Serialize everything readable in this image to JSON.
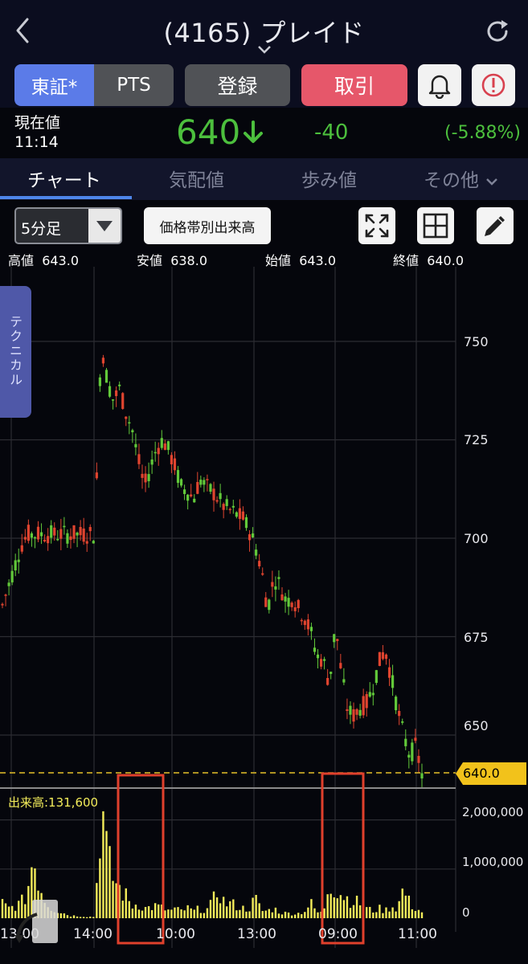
{
  "header": {
    "title": "(4165) プレイド"
  },
  "buttons": {
    "tse": "東証*",
    "pts": "PTS",
    "register": "登録",
    "trade": "取引"
  },
  "price": {
    "label": "現在値",
    "time": "11:14",
    "value": "640",
    "change": "-40",
    "change_pct": "(-5.88%)",
    "color_down": "#4cbf3d"
  },
  "tabs": [
    {
      "label": "チャート",
      "active": true
    },
    {
      "label": "気配値"
    },
    {
      "label": "歩み値"
    },
    {
      "label": "その他"
    }
  ],
  "toolbar": {
    "interval": "5分足",
    "volume_profile": "価格帯別出来高"
  },
  "ohlc": {
    "high_label": "高値",
    "high": "643.0",
    "low_label": "安値",
    "low": "638.0",
    "open_label": "始値",
    "open": "643.0",
    "close_label": "終値",
    "close": "640.0"
  },
  "side_tab": "テクニカル",
  "chart": {
    "y_ticks": [
      "750",
      "725",
      "700",
      "675",
      "650"
    ],
    "last_price_tag": "640.0",
    "volume_label": "出来高:131,600",
    "volume_ticks": [
      "2,000,000",
      "1,000,000",
      "0"
    ],
    "x_ticks": [
      "13:00",
      "14:00",
      "10:00",
      "13:00",
      "09:00",
      "11:00"
    ],
    "up_color": "#e0442f",
    "down_color": "#62c93a",
    "highlight_color": "#e0402c"
  },
  "chart_data": {
    "type": "candlestick",
    "y_ticks": [
      750,
      725,
      700,
      675,
      650
    ],
    "last_price": 640.0,
    "volume_y_ticks": [
      2000000,
      1000000,
      0
    ],
    "x_ticks": [
      "13:00",
      "14:00",
      "10:00",
      "13:00",
      "09:00",
      "11:00"
    ],
    "price_path": [
      683,
      688,
      693,
      698,
      701,
      701,
      701,
      701,
      701,
      701,
      701,
      701,
      701,
      701,
      701,
      701,
      750,
      740,
      735,
      738,
      732,
      728,
      720,
      713,
      718,
      723,
      725,
      722,
      718,
      713,
      712,
      710,
      715,
      713,
      712,
      710,
      708,
      707,
      706,
      705,
      702,
      698,
      692,
      682,
      690,
      688,
      684,
      685,
      682,
      680,
      676,
      670,
      669,
      663,
      678,
      665,
      656,
      655,
      657,
      658,
      662,
      668,
      672,
      665,
      657,
      650,
      645,
      647,
      640
    ],
    "volume_path": [
      0.3,
      0.2,
      0.25,
      0.3,
      0.5,
      1.3,
      0.7,
      0.35,
      0.2,
      0.15,
      0.1,
      0.05,
      0.05,
      0.04,
      0.03,
      0.03,
      2.4,
      1.2,
      0.8,
      0.6,
      0.45,
      0.25,
      0.3,
      0.2,
      0.22,
      0.25,
      0.2,
      0.15,
      0.18,
      0.15,
      0.2,
      0.14,
      0.2,
      0.15,
      0.3,
      0.6,
      0.3,
      0.3,
      0.25,
      0.2,
      0.2,
      0.4,
      0.15,
      0.15,
      0.2,
      0.12,
      0.1,
      0.1,
      0.1,
      0.15,
      0.3,
      0.12,
      0.1,
      0.8,
      0.6,
      0.5,
      0.4,
      0.35,
      0.3,
      0.2,
      0.15,
      0.2,
      0.15,
      0.25,
      0.2,
      0.6,
      0.3,
      0.2,
      0.13
    ]
  }
}
